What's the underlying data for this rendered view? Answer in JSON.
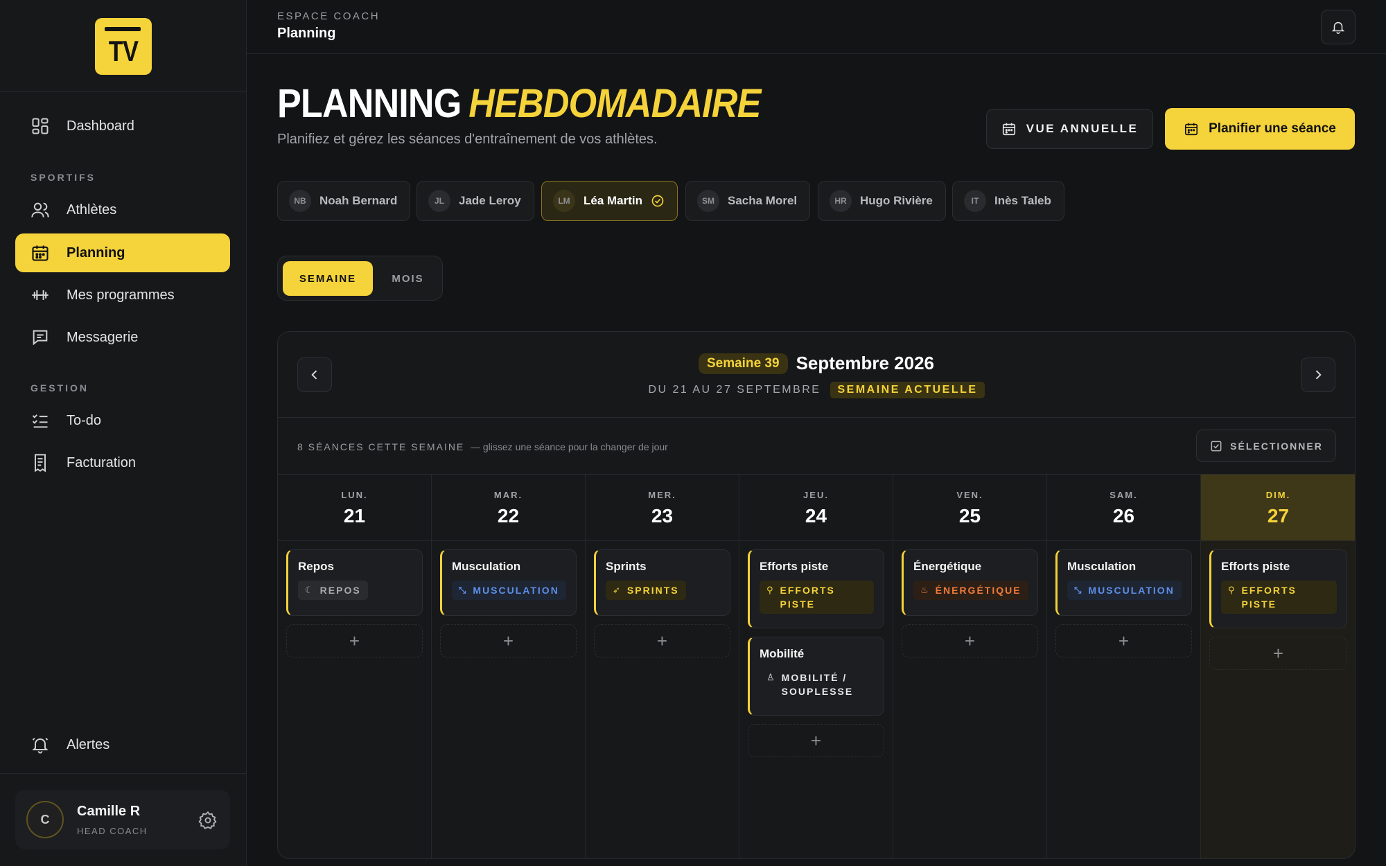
{
  "app": {
    "logo_text": "TV",
    "brand_color": "#f5d33a"
  },
  "sidebar": {
    "nav_main": [
      {
        "label": "Dashboard",
        "icon": "dashboard-icon"
      }
    ],
    "section_sportifs": "SPORTIFS",
    "nav_sportifs": [
      {
        "label": "Athlètes",
        "icon": "users-icon"
      },
      {
        "label": "Planning",
        "icon": "calendar-icon",
        "active": true
      },
      {
        "label": "Mes programmes",
        "icon": "dumbbell-icon"
      },
      {
        "label": "Messagerie",
        "icon": "chat-icon"
      }
    ],
    "section_gestion": "GESTION",
    "nav_gestion": [
      {
        "label": "To-do",
        "icon": "checklist-icon"
      },
      {
        "label": "Facturation",
        "icon": "receipt-icon"
      }
    ],
    "alerts_label": "Alertes",
    "user": {
      "initial": "C",
      "name": "Camille R",
      "role": "HEAD COACH"
    }
  },
  "topbar": {
    "eyebrow": "ESPACE COACH",
    "title": "Planning"
  },
  "header": {
    "title_plain": "PLANNING",
    "title_accent": "HEBDOMADAIRE",
    "subtitle": "Planifiez et gérez les séances d'entraînement de vos athlètes.",
    "btn_annual": "VUE ANNUELLE",
    "btn_plan": "Planifier une séance"
  },
  "athletes": [
    {
      "initials": "NB",
      "name": "Noah Bernard"
    },
    {
      "initials": "JL",
      "name": "Jade Leroy"
    },
    {
      "initials": "LM",
      "name": "Léa Martin",
      "selected": true
    },
    {
      "initials": "SM",
      "name": "Sacha Morel"
    },
    {
      "initials": "HR",
      "name": "Hugo Rivière"
    },
    {
      "initials": "IT",
      "name": "Inès Taleb"
    }
  ],
  "view_toggle": {
    "week": "SEMAINE",
    "month": "MOIS",
    "active": "week"
  },
  "calendar": {
    "week_badge": "Semaine 39",
    "month_label": "Septembre 2026",
    "range": "DU 21 AU 27 SEPTEMBRE",
    "current_badge": "SEMAINE ACTUELLE",
    "count": "8 SÉANCES CETTE SEMAINE",
    "hint": "— glissez une séance pour la changer de jour",
    "select_btn": "SÉLECTIONNER",
    "add_symbol": "+",
    "days": [
      {
        "name": "LUN.",
        "num": "21",
        "sessions": [
          {
            "title": "Repos",
            "tag": "REPOS",
            "tag_lines": [
              "REPOS"
            ],
            "kind": "gray",
            "icon": "moon-icon"
          }
        ]
      },
      {
        "name": "MAR.",
        "num": "22",
        "sessions": [
          {
            "title": "Musculation",
            "tag": "MUSCULATION",
            "tag_lines": [
              "MUSCULATION"
            ],
            "kind": "blue",
            "icon": "dumbbell-icon"
          }
        ]
      },
      {
        "name": "MER.",
        "num": "23",
        "sessions": [
          {
            "title": "Sprints",
            "tag": "SPRINTS",
            "tag_lines": [
              "SPRINTS"
            ],
            "kind": "yellow",
            "icon": "rocket-icon"
          }
        ]
      },
      {
        "name": "JEU.",
        "num": "24",
        "sessions": [
          {
            "title": "Efforts piste",
            "tag": "EFFORTS PISTE",
            "tag_lines": [
              "EFFORTS",
              "PISTE"
            ],
            "kind": "yellow",
            "icon": "bike-icon"
          },
          {
            "title": "Mobilité",
            "tag": "MOBILITÉ / SOUPLESSE",
            "tag_lines": [
              "MOBILITÉ /",
              "SOUPLESSE"
            ],
            "kind": "white",
            "icon": "stretch-icon"
          }
        ]
      },
      {
        "name": "VEN.",
        "num": "25",
        "sessions": [
          {
            "title": "Énergétique",
            "tag": "ÉNERGÉTIQUE",
            "tag_lines": [
              "ÉNERGÉTIQUE"
            ],
            "kind": "orange",
            "icon": "flame-icon"
          }
        ]
      },
      {
        "name": "SAM.",
        "num": "26",
        "sessions": [
          {
            "title": "Musculation",
            "tag": "MUSCULATION",
            "tag_lines": [
              "MUSCULATION"
            ],
            "kind": "blue",
            "icon": "dumbbell-icon"
          }
        ]
      },
      {
        "name": "DIM.",
        "num": "27",
        "today": true,
        "sessions": [
          {
            "title": "Efforts piste",
            "tag": "EFFORTS PISTE",
            "tag_lines": [
              "EFFORTS",
              "PISTE"
            ],
            "kind": "yellow",
            "icon": "bike-icon"
          }
        ]
      }
    ]
  }
}
